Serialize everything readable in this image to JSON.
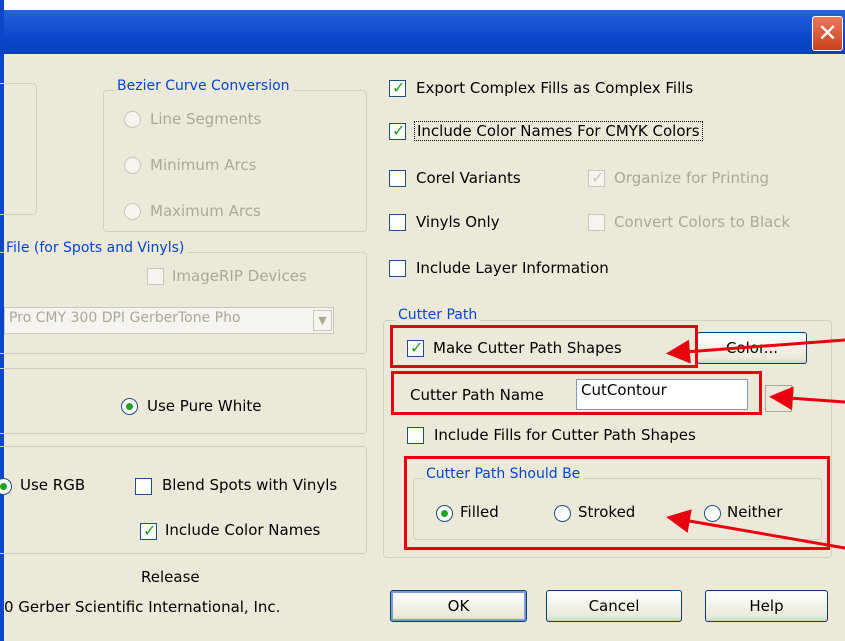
{
  "window": {
    "close_label": "✕"
  },
  "bezier": {
    "title": "Bezier Curve Conversion",
    "options": [
      "Line Segments",
      "Minimum Arcs",
      "Maximum Arcs"
    ]
  },
  "file_group": {
    "title": "File (for Spots and Vinyls)",
    "imagerip_label": "ImageRIP Devices",
    "profile_value": "Pro CMY 300 DPI GerberTone Pho"
  },
  "white": {
    "label": "Use Pure White",
    "selected": true
  },
  "color": {
    "use_rgb_label": "Use RGB",
    "blend_label": "Blend Spots with Vinyls",
    "include_names_label": "Include Color Names",
    "include_names_checked": true
  },
  "release": {
    "label": "Release",
    "copyright": "0 Gerber Scientific International, Inc."
  },
  "export": {
    "complex_fills_label": "Export Complex Fills as Complex Fills",
    "complex_fills_checked": true,
    "cmyk_names_label": "Include Color Names For CMYK Colors",
    "cmyk_names_checked": true,
    "corel_label": "Corel Variants",
    "organize_label": "Organize for Printing",
    "vinyls_label": "Vinyls Only",
    "convert_black_label": "Convert Colors to Black",
    "layer_label": "Include Layer Information"
  },
  "cutter": {
    "title": "Cutter Path",
    "make_shapes_label": "Make Cutter Path Shapes",
    "make_shapes_checked": true,
    "color_button": "Color...",
    "name_label": "Cutter Path Name",
    "name_value": "CutContour",
    "include_fills_label": "Include Fills for Cutter Path Shapes",
    "should_be_title": "Cutter Path Should Be",
    "should_be_options": [
      "Filled",
      "Stroked",
      "Neither"
    ],
    "should_be_selected": "Filled"
  },
  "buttons": {
    "ok": "OK",
    "cancel": "Cancel",
    "help": "Help"
  },
  "colors": {
    "title_bar": "#0a46c8",
    "dialog_bg": "#ece9d8",
    "highlight_box": "#e8000f",
    "group_legend": "#0046d5"
  }
}
